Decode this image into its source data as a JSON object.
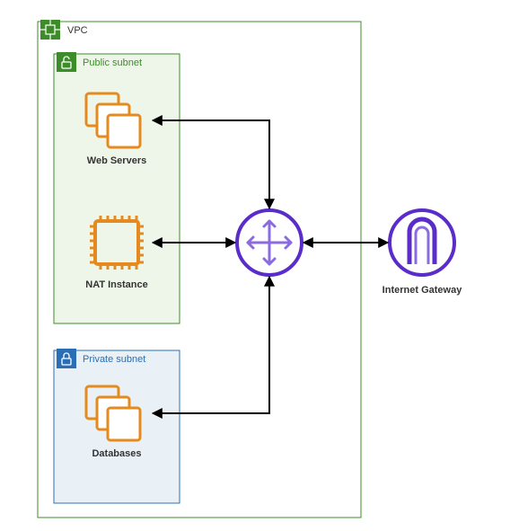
{
  "diagram": {
    "vpc": {
      "label": "VPC",
      "color": "#3C8C2A"
    },
    "public_subnet": {
      "label": "Public subnet",
      "color": "#3C8C2A",
      "fill": "#EEF6E9",
      "items": {
        "web_servers": {
          "label": "Web Servers"
        },
        "nat_instance": {
          "label": "NAT Instance"
        }
      }
    },
    "private_subnet": {
      "label": "Private subnet",
      "color": "#2A6FB5",
      "fill": "#E9F0F6",
      "items": {
        "databases": {
          "label": "Databases"
        }
      }
    },
    "router": {
      "label": ""
    },
    "internet_gateway": {
      "label": "Internet Gateway"
    },
    "icon_color": "#E58A1F",
    "purple": "#5A2CC9"
  },
  "connections": [
    {
      "from": "web_servers",
      "to": "router",
      "bidirectional": true
    },
    {
      "from": "nat_instance",
      "to": "router",
      "bidirectional": true
    },
    {
      "from": "databases",
      "to": "router",
      "bidirectional": true
    },
    {
      "from": "router",
      "to": "internet_gateway",
      "bidirectional": true
    }
  ]
}
